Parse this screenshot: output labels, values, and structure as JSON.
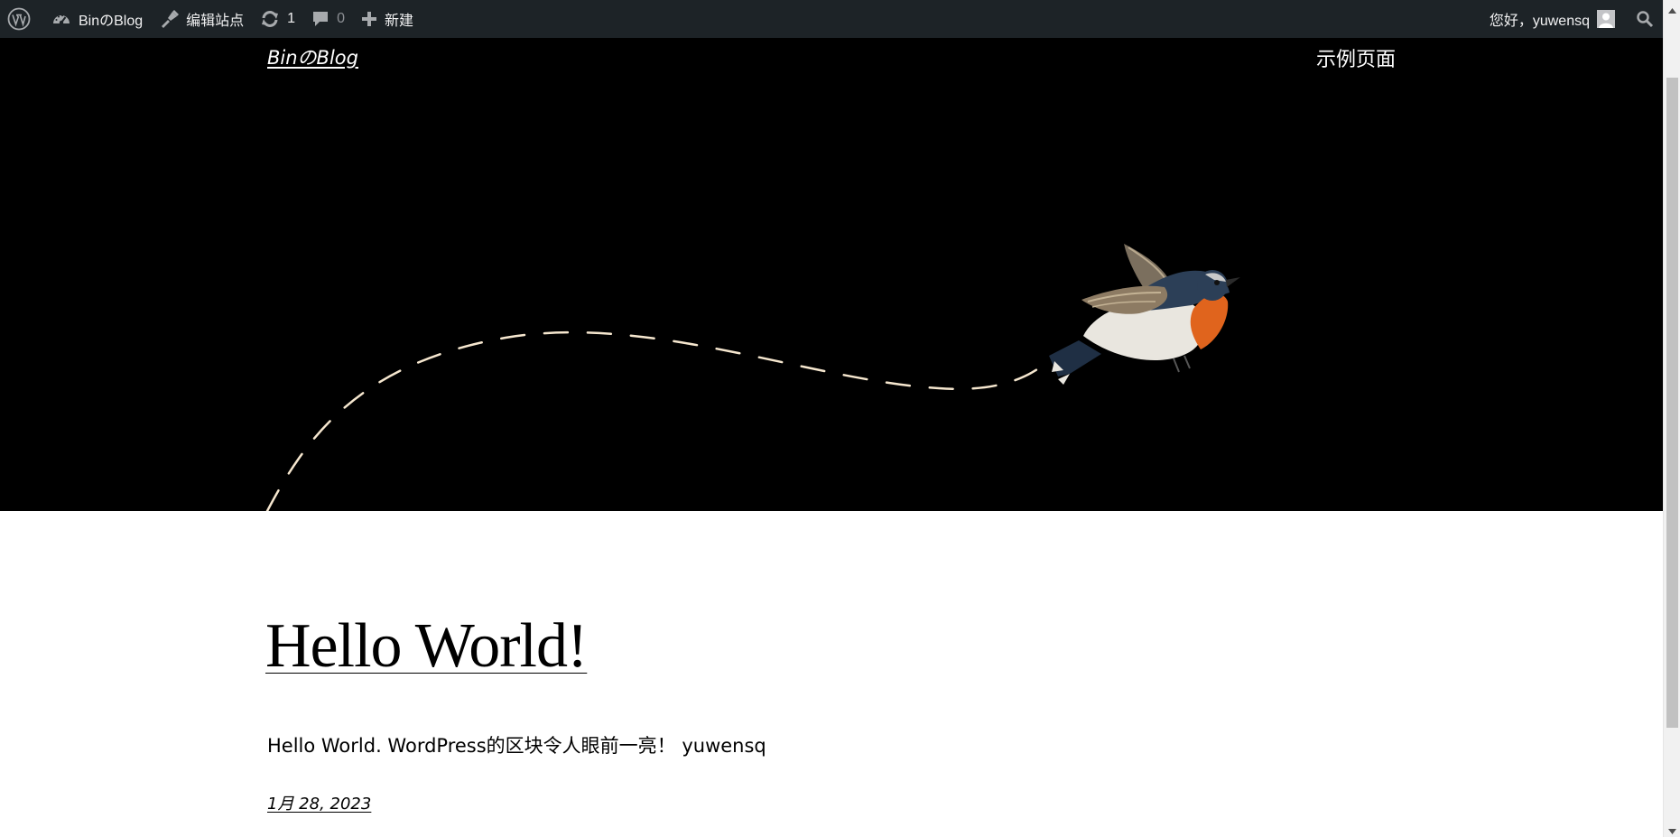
{
  "admin_bar": {
    "site_name": "BinのBlog",
    "edit_site_label": "编辑站点",
    "updates_count": "1",
    "comments_count": "0",
    "new_label": "新建",
    "greeting": "您好，yuwensq"
  },
  "header": {
    "site_title": "BinのBlog",
    "nav": [
      "示例页面"
    ]
  },
  "post": {
    "title": "Hello World!",
    "excerpt": "Hello World. WordPress的区块令人眼前一亮！ yuwensq",
    "date": "1月 28, 2023"
  },
  "icons": {
    "wordpress": "wordpress-logo-icon",
    "dashboard": "dashboard-icon",
    "edit": "pencil-brush-icon",
    "updates": "refresh-icon",
    "comments": "comment-bubble-icon",
    "new": "plus-icon",
    "avatar": "user-avatar-icon",
    "search": "search-icon"
  },
  "colors": {
    "admin_bar_bg": "#1d2327",
    "hero_bg": "#000000",
    "path_dash": "#f6e7cf",
    "bird_orange": "#e0641d",
    "bird_blue": "#2c3f57"
  }
}
